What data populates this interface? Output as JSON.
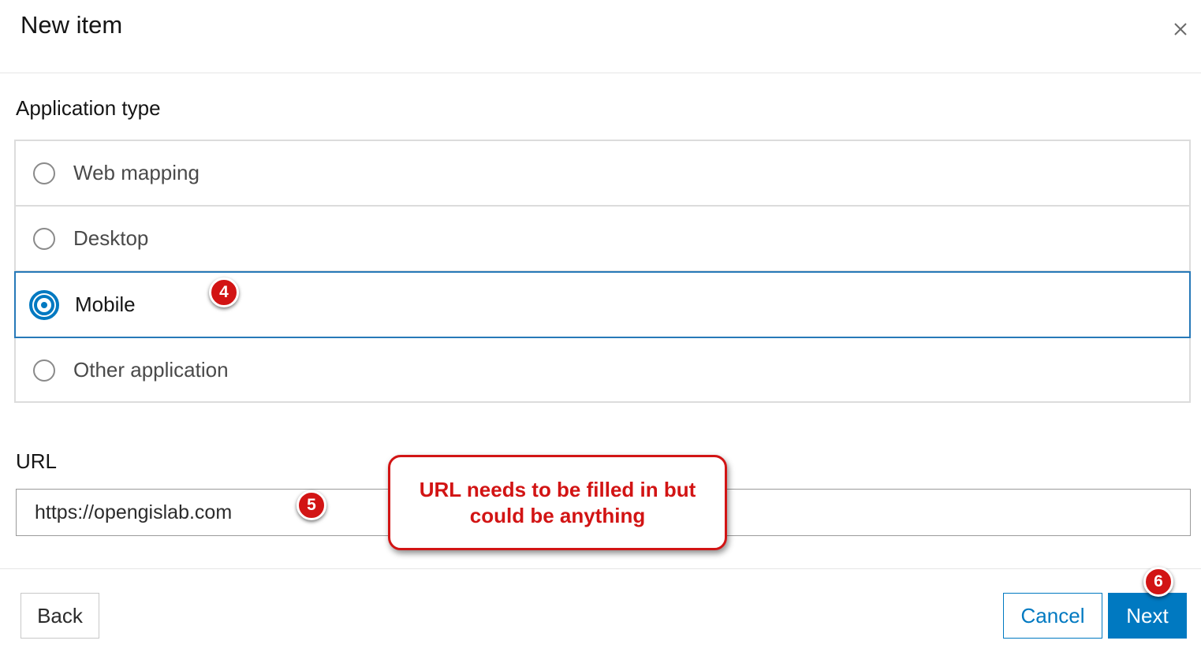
{
  "dialog": {
    "title": "New item",
    "close_icon": "close-icon"
  },
  "application_type": {
    "label": "Application type",
    "options": [
      {
        "label": "Web mapping",
        "selected": false
      },
      {
        "label": "Desktop",
        "selected": false
      },
      {
        "label": "Mobile",
        "selected": true
      },
      {
        "label": "Other application",
        "selected": false
      }
    ]
  },
  "url": {
    "label": "URL",
    "value": "https://opengislab.com"
  },
  "footer": {
    "back_label": "Back",
    "cancel_label": "Cancel",
    "next_label": "Next"
  },
  "annotations": {
    "step_4": "4",
    "step_5": "5",
    "step_6": "6",
    "callout_text": "URL needs to be filled in but could be anything",
    "accent_color": "#d21414"
  },
  "colors": {
    "primary": "#0079c1",
    "border": "#dcdcdc"
  }
}
